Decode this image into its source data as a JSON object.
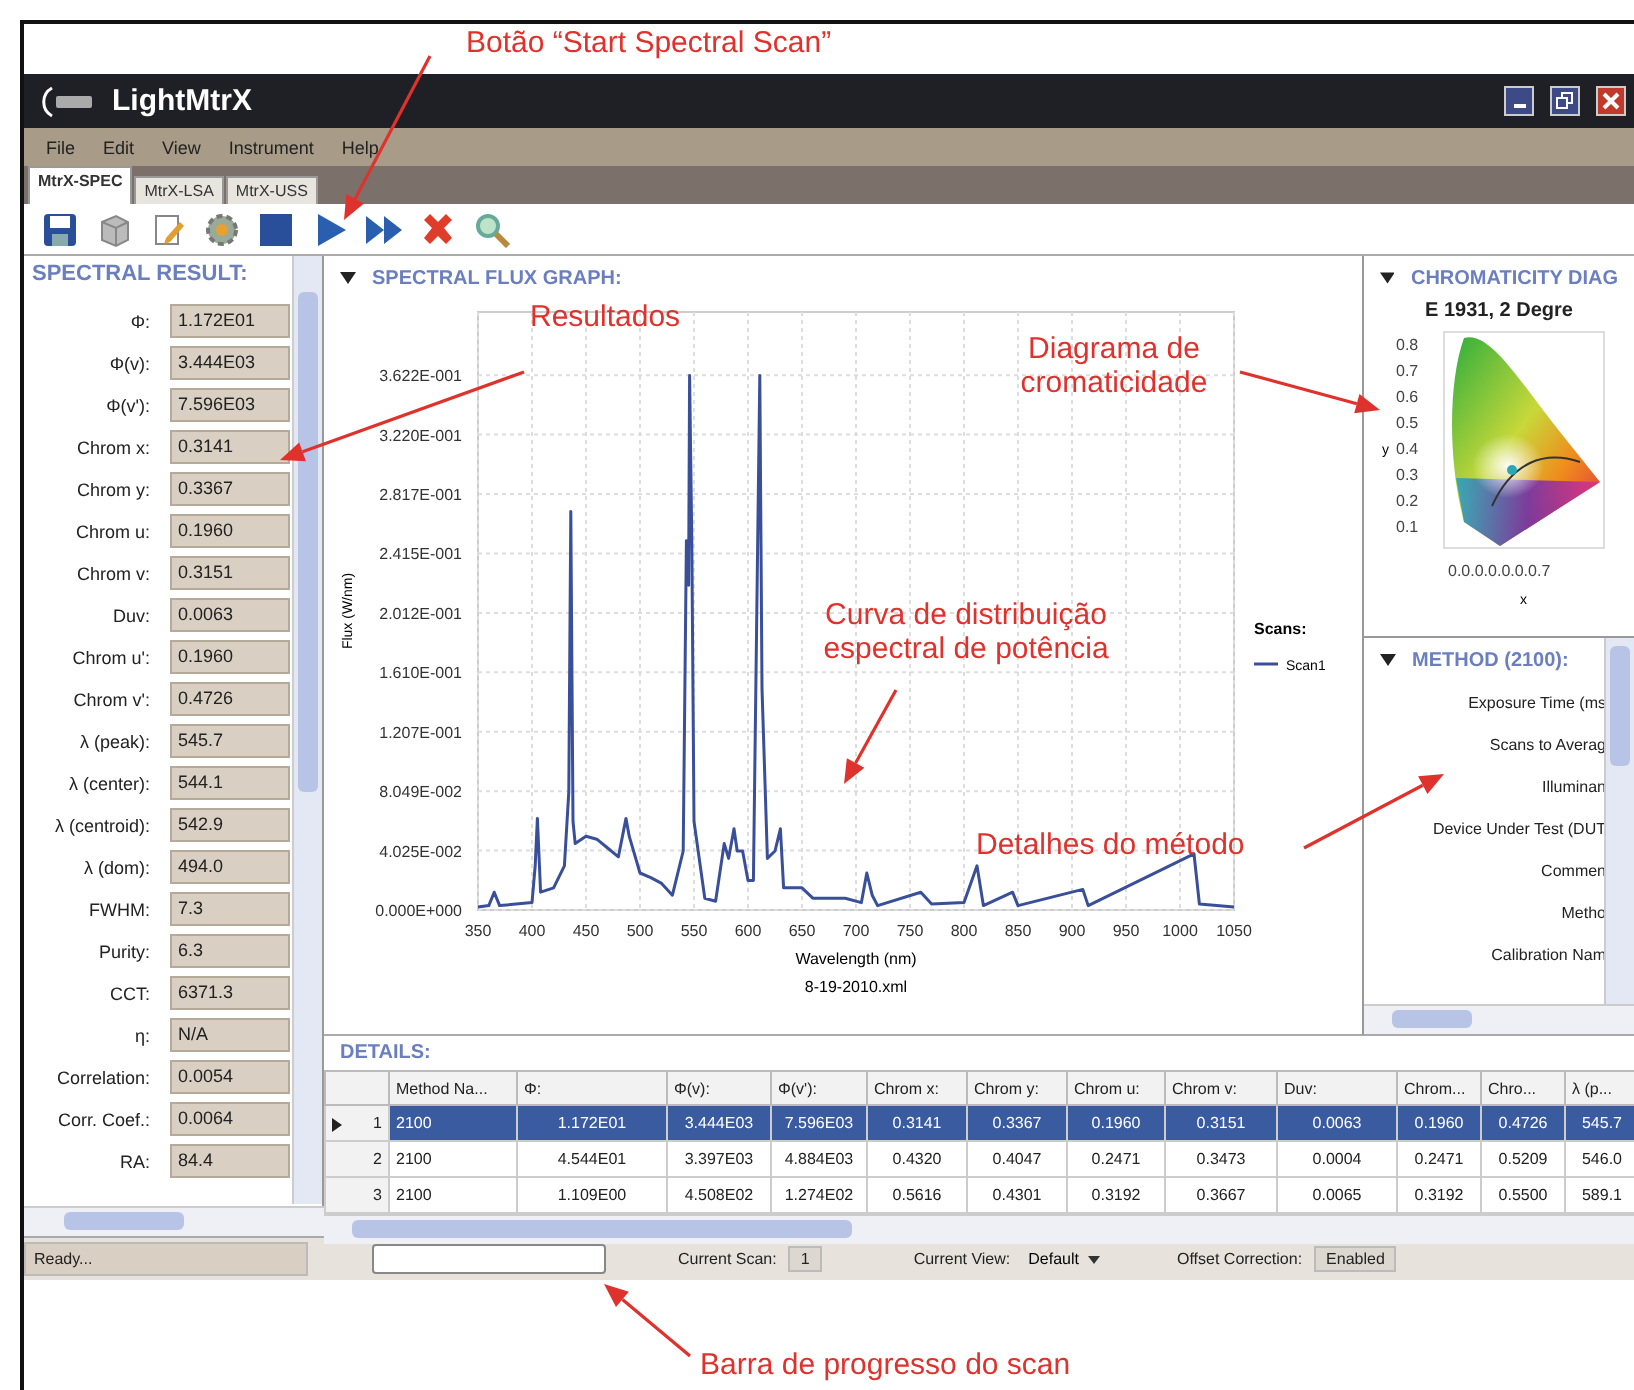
{
  "annotations": [
    {
      "text": "Botão “Start Spectral Scan”"
    },
    {
      "text": "Resultados"
    },
    {
      "text": "Diagrama de cromaticidade"
    },
    {
      "text": "Curva de distribuição espectral de potência"
    },
    {
      "text": "Detalhes do método"
    },
    {
      "text": "Barra de progresso do scan"
    }
  ],
  "window": {
    "title": "LightMtrX"
  },
  "menu": [
    "File",
    "Edit",
    "View",
    "Instrument",
    "Help"
  ],
  "tabs": [
    {
      "label": "MtrX-SPEC",
      "selected": true
    },
    {
      "label": "MtrX-LSA",
      "selected": false
    },
    {
      "label": "MtrX-USS",
      "selected": false
    }
  ],
  "results": {
    "title": "SPECTRAL RESULT:",
    "rows": [
      {
        "label": "Φ:",
        "value": "1.172E01"
      },
      {
        "label": "Φ(v):",
        "value": "3.444E03"
      },
      {
        "label": "Φ(v'):",
        "value": "7.596E03"
      },
      {
        "label": "Chrom x:",
        "value": "0.3141"
      },
      {
        "label": "Chrom y:",
        "value": "0.3367"
      },
      {
        "label": "Chrom u:",
        "value": "0.1960"
      },
      {
        "label": "Chrom v:",
        "value": "0.3151"
      },
      {
        "label": "Duv:",
        "value": "0.0063"
      },
      {
        "label": "Chrom u':",
        "value": "0.1960"
      },
      {
        "label": "Chrom v':",
        "value": "0.4726"
      },
      {
        "label": "λ (peak):",
        "value": "545.7"
      },
      {
        "label": "λ (center):",
        "value": "544.1"
      },
      {
        "label": "λ (centroid):",
        "value": "542.9"
      },
      {
        "label": "λ (dom):",
        "value": "494.0"
      },
      {
        "label": "FWHM:",
        "value": "7.3"
      },
      {
        "label": "Purity:",
        "value": "6.3"
      },
      {
        "label": "CCT:",
        "value": "6371.3"
      },
      {
        "label": "η:",
        "value": "N/A"
      },
      {
        "label": "Correlation:",
        "value": "0.0054"
      },
      {
        "label": "Corr. Coef.:",
        "value": "0.0064"
      },
      {
        "label": "RA:",
        "value": "84.4"
      }
    ]
  },
  "graph": {
    "title": "SPECTRAL FLUX GRAPH:",
    "file": "8-19-2010.xml",
    "legend_title": "Scans:",
    "chart_data": {
      "type": "line",
      "grid": true,
      "xlabel": "Wavelength (nm)",
      "ylabel": "Flux (W/nm)",
      "xlim": [
        350,
        1050
      ],
      "ylim": [
        0,
        0.405
      ],
      "xticks": [
        350,
        400,
        450,
        500,
        550,
        600,
        650,
        700,
        750,
        800,
        850,
        900,
        950,
        1000,
        1050
      ],
      "yticks": [
        {
          "value": 0,
          "label": "0.000E+000"
        },
        {
          "value": 0.04025,
          "label": "4.025E-002"
        },
        {
          "value": 0.08049,
          "label": "8.049E-002"
        },
        {
          "value": 0.1207,
          "label": "1.207E-001"
        },
        {
          "value": 0.161,
          "label": "1.610E-001"
        },
        {
          "value": 0.2012,
          "label": "2.012E-001"
        },
        {
          "value": 0.2415,
          "label": "2.415E-001"
        },
        {
          "value": 0.2817,
          "label": "2.817E-001"
        },
        {
          "value": 0.322,
          "label": "3.220E-001"
        },
        {
          "value": 0.3622,
          "label": "3.622E-001"
        }
      ],
      "x": [
        350,
        360,
        365,
        370,
        400,
        403,
        405,
        408,
        420,
        430,
        434,
        436,
        438,
        440,
        450,
        460,
        470,
        480,
        487,
        490,
        500,
        510,
        520,
        530,
        540,
        543,
        545,
        546,
        548,
        550,
        560,
        570,
        578,
        582,
        587,
        590,
        595,
        600,
        605,
        611,
        613,
        618,
        625,
        630,
        633,
        650,
        660,
        690,
        705,
        710,
        715,
        720,
        760,
        770,
        800,
        812,
        818,
        845,
        850,
        910,
        915,
        1013,
        1018,
        1050
      ],
      "series": [
        {
          "name": "Scan1",
          "color": "#3a4f9a",
          "values": [
            0.002,
            0.003,
            0.012,
            0.003,
            0.005,
            0.03,
            0.062,
            0.012,
            0.015,
            0.03,
            0.08,
            0.27,
            0.06,
            0.045,
            0.05,
            0.048,
            0.042,
            0.036,
            0.062,
            0.05,
            0.025,
            0.022,
            0.018,
            0.01,
            0.04,
            0.25,
            0.22,
            0.362,
            0.25,
            0.06,
            0.008,
            0.006,
            0.045,
            0.035,
            0.055,
            0.04,
            0.04,
            0.02,
            0.02,
            0.362,
            0.15,
            0.035,
            0.04,
            0.055,
            0.015,
            0.015,
            0.008,
            0.008,
            0.005,
            0.025,
            0.01,
            0.003,
            0.012,
            0.004,
            0.005,
            0.03,
            0.003,
            0.012,
            0.003,
            0.014,
            0.003,
            0.038,
            0.004,
            0.002
          ]
        }
      ]
    }
  },
  "chromaticity": {
    "title": "CHROMATICITY DIAG",
    "subtitle": "E 1931, 2 Degre",
    "yticks": [
      "0.8",
      "0.7",
      "0.6",
      "0.5",
      "0.4",
      "0.3",
      "0.2",
      "0.1"
    ],
    "xticks": "0.0.0.0.0.0.0.7",
    "xlabel": "x",
    "ylabel": "y"
  },
  "method": {
    "title": "METHOD (2100):",
    "labels": [
      "Exposure Time (ms",
      "Scans to Averag",
      "Illuminan",
      "Device Under Test (DUT",
      "Commen",
      "Metho",
      "Calibration Nam"
    ]
  },
  "details": {
    "title": "DETAILS:",
    "columns": [
      "Method Na...",
      "Φ:",
      "Φ(v):",
      "Φ(v'):",
      "Chrom x:",
      "Chrom y:",
      "Chrom u:",
      "Chrom v:",
      "Duv:",
      "Chrom...",
      "Chro...",
      "λ (p..."
    ],
    "rows": [
      {
        "number": "1",
        "selected": true,
        "cells": [
          "2100",
          "1.172E01",
          "3.444E03",
          "7.596E03",
          "0.3141",
          "0.3367",
          "0.1960",
          "0.3151",
          "0.0063",
          "0.1960",
          "0.4726",
          "545.7"
        ]
      },
      {
        "number": "2",
        "selected": false,
        "cells": [
          "2100",
          "4.544E01",
          "3.397E03",
          "4.884E03",
          "0.4320",
          "0.4047",
          "0.2471",
          "0.3473",
          "0.0004",
          "0.2471",
          "0.5209",
          "546.0"
        ]
      },
      {
        "number": "3",
        "selected": false,
        "cells": [
          "2100",
          "1.109E00",
          "4.508E02",
          "1.274E02",
          "0.5616",
          "0.4301",
          "0.3192",
          "0.3667",
          "0.0065",
          "0.3192",
          "0.5500",
          "589.1"
        ]
      }
    ]
  },
  "status_bar": {
    "status": "Ready...",
    "progress": {
      "level": 0
    },
    "current_scan_label": "Current Scan:",
    "current_scan": "1",
    "current_view_label": "Current View:",
    "current_view": "Default",
    "offset_label": "Offset Correction:",
    "offset": "Enabled"
  }
}
